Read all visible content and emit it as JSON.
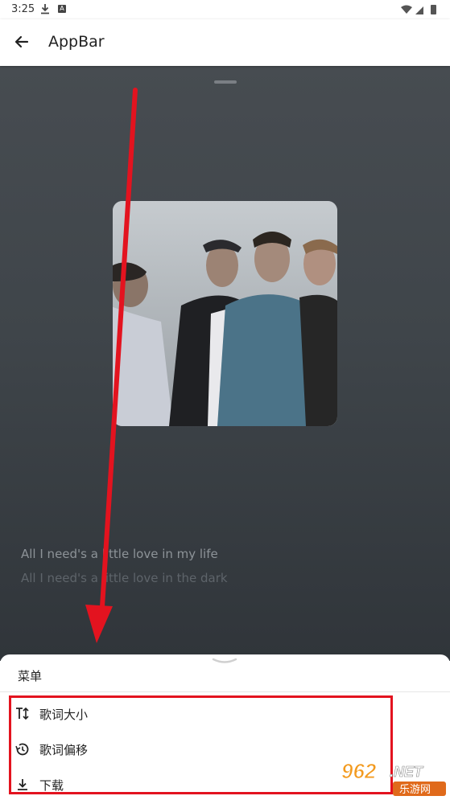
{
  "status_bar": {
    "time": "3:25"
  },
  "app_bar": {
    "title": "AppBar"
  },
  "player": {
    "lyrics": [
      "All I need's a little love in my life",
      "All I need's a little love in the dark"
    ]
  },
  "menu_sheet": {
    "title": "菜单",
    "items": [
      {
        "label": "歌词大小",
        "icon": "text-size-icon"
      },
      {
        "label": "歌词偏移",
        "icon": "history-clock-icon"
      },
      {
        "label": "下载",
        "icon": "download-icon"
      }
    ]
  },
  "watermark": {
    "text": "962.NET",
    "subtext": "乐游网"
  },
  "colors": {
    "annotation_red": "#e3131f",
    "player_bg": "#3f454a"
  }
}
